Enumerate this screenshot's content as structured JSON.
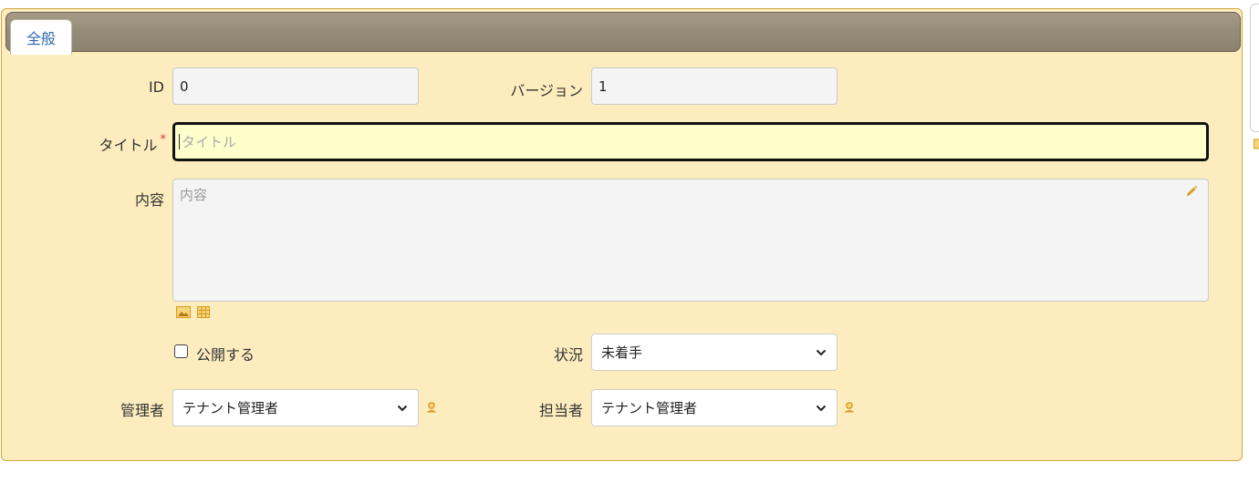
{
  "tab": {
    "label": "全般"
  },
  "fields": {
    "id": {
      "label": "ID",
      "value": "0"
    },
    "version": {
      "label": "バージョン",
      "value": "1"
    },
    "title": {
      "label": "タイトル",
      "required_mark": "*",
      "placeholder": "タイトル",
      "value": ""
    },
    "content": {
      "label": "内容",
      "placeholder": "内容"
    },
    "publish": {
      "label": "公開する",
      "checked": false
    },
    "status": {
      "label": "状況",
      "value": "未着手"
    },
    "manager": {
      "label": "管理者",
      "value": "テナント管理者"
    },
    "owner": {
      "label": "担当者",
      "value": "テナント管理者"
    }
  },
  "icons": {
    "edit": "pencil-icon",
    "image": "image-icon",
    "table": "table-icon",
    "user": "user-icon",
    "accent": "#d99a1e"
  }
}
